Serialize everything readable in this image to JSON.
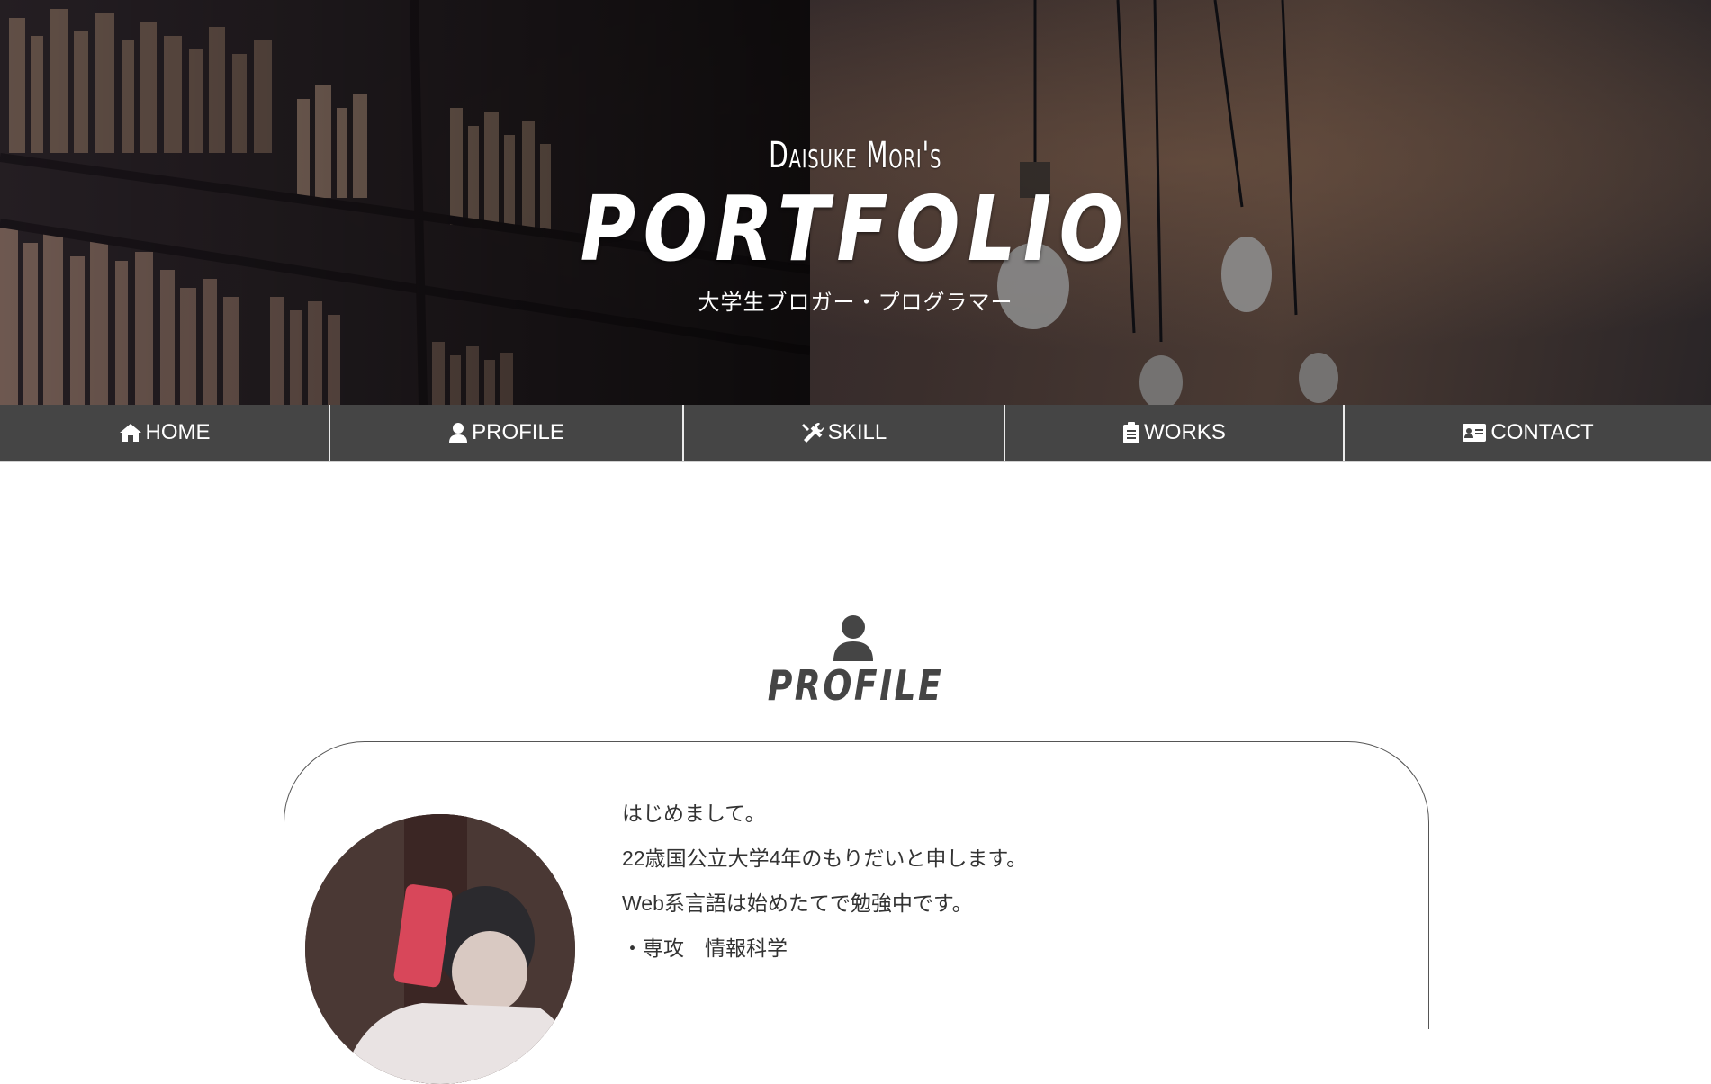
{
  "hero": {
    "owner": "Daisuke Mori's",
    "title": "PORTFOLIO",
    "tagline": "大学生ブロガー・プログラマー"
  },
  "nav": {
    "items": [
      {
        "label": "HOME",
        "icon": "home-icon"
      },
      {
        "label": "PROFILE",
        "icon": "user-icon"
      },
      {
        "label": "SKILL",
        "icon": "tools-icon"
      },
      {
        "label": "WORKS",
        "icon": "clipboard-icon"
      },
      {
        "label": "CONTACT",
        "icon": "id-card-icon"
      }
    ]
  },
  "profile": {
    "heading": "PROFILE",
    "icon": "user-icon",
    "bio": [
      "はじめまして。",
      "22歳国公立大学4年のもりだいと申します。",
      "Web系言語は始めたてで勉強中です。",
      "・専攻　情報科学"
    ]
  },
  "colors": {
    "nav_bg": "#454545",
    "heading": "#454545",
    "text": "#333333"
  }
}
